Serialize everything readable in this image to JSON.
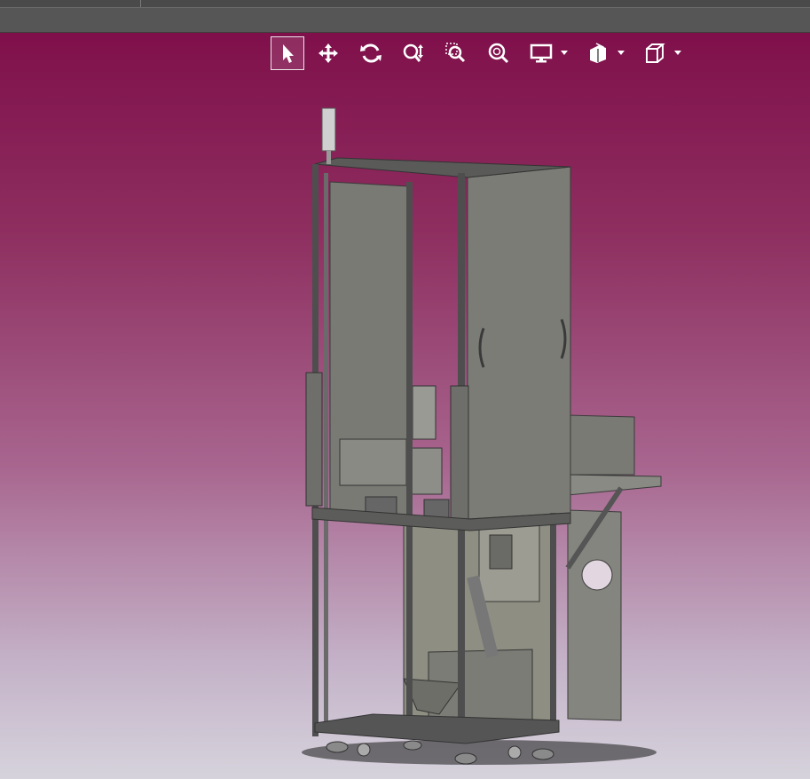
{
  "colors": {
    "viewport_top": "#7d0a47",
    "viewport_bottom": "#d6d3dc",
    "toolbar_bar": "#565656",
    "icon": "#ffffff",
    "model_panel": "#7b7b76",
    "model_frame": "#505050"
  },
  "toolbar": {
    "tools": [
      {
        "icon": "select-arrow-icon",
        "active": true
      },
      {
        "icon": "pan-move-icon",
        "active": false
      },
      {
        "icon": "rotate-icon",
        "active": false
      },
      {
        "icon": "zoom-in-out-icon",
        "active": false
      },
      {
        "icon": "zoom-area-icon",
        "active": false
      },
      {
        "icon": "zoom-fit-icon",
        "active": false
      }
    ],
    "dropdown_tools": [
      {
        "icon": "display-mode-icon"
      },
      {
        "icon": "section-view-icon"
      },
      {
        "icon": "view-cube-icon"
      }
    ]
  },
  "model": {
    "description_icon": "cad-machine-assembly-3d"
  }
}
